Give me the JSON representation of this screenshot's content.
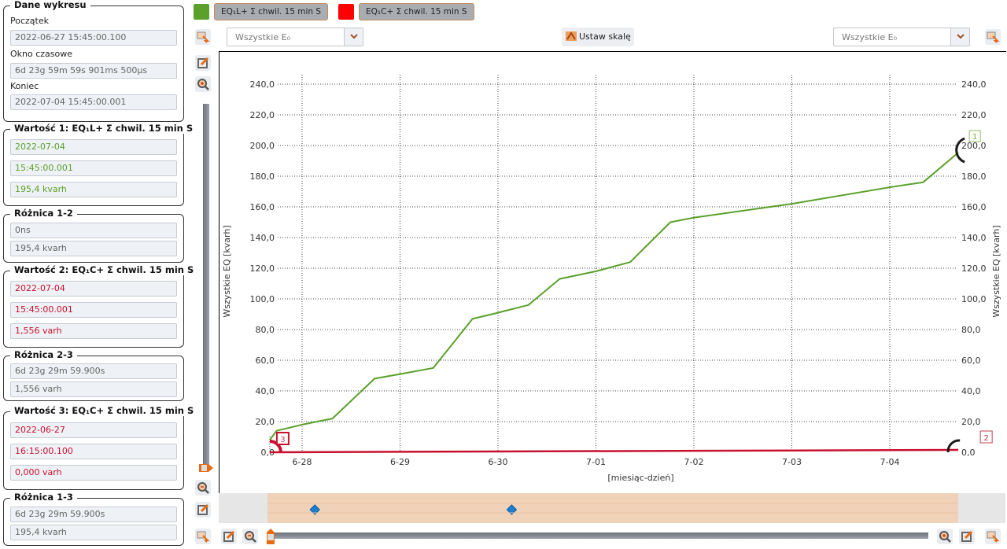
{
  "legend": {
    "series1": {
      "label": "EQ₁L+ Σ chwil. 15 min S",
      "color": "#5aa02a"
    },
    "series2": {
      "label": "EQ₁C+ Σ chwil. 15 min S",
      "color": "#e8140c"
    }
  },
  "toolbar": {
    "left_dropdown": "Wszystkie E₀",
    "right_dropdown": "Wszystkie E₀",
    "set_scale_label": "Ustaw skalę"
  },
  "panel": {
    "chart_data_group": {
      "title": "Dane wykresu",
      "start_label": "Początek",
      "start_value": "2022-06-27 15:45:00.100",
      "window_label": "Okno czasowe",
      "window_value": "6d 23g 59m 59s 901ms 500µs",
      "end_label": "Koniec",
      "end_value": "2022-07-04 15:45:00.001"
    },
    "value1": {
      "title": "Wartość 1: EQ₁L+ Σ chwil. 15 min S",
      "date": "2022-07-04",
      "time": "15:45:00.001",
      "value": "195,4 kvarh"
    },
    "diff12": {
      "title": "Różnica 1-2",
      "time": "0ns",
      "value": "195,4 kvarh"
    },
    "value2": {
      "title": "Wartość 2: EQ₁C+ Σ chwil. 15 min S",
      "date": "2022-07-04",
      "time": "15:45:00.001",
      "value": "1,556 varh"
    },
    "diff23": {
      "title": "Różnica 2-3",
      "time": "6d 23g 29m 59.900s",
      "value": "1,556 varh"
    },
    "value3": {
      "title": "Wartość 3: EQ₁C+ Σ chwil. 15 min S",
      "date": "2022-06-27",
      "time": "16:15:00.100",
      "value": "0,000 varh"
    },
    "diff13": {
      "title": "Różnica 1-3",
      "time": "6d 23g 29m 59.900s",
      "value": "195,4 kvarh"
    }
  },
  "chart_data": {
    "type": "line",
    "xlabel": "[miesiąc-dzień]",
    "ylabel_left": "Wszystkie EQ [kvarh]",
    "ylabel_right": "Wszystkie EQ [kvarh]",
    "ylim": [
      0,
      240
    ],
    "yticks": [
      "0,0",
      "20,0",
      "40,0",
      "60,0",
      "80,0",
      "100,0",
      "120,0",
      "140,0",
      "160,0",
      "180,0",
      "200,0",
      "220,0",
      "240,0"
    ],
    "xlim_days": [
      -0.33,
      6.72
    ],
    "xticks": [
      "6-28",
      "6-29",
      "6-30",
      "7-01",
      "7-02",
      "7-03",
      "7-04"
    ],
    "grid": true,
    "series": [
      {
        "name": "EQ₁L+ Σ chwil. 15 min S",
        "color": "#5aa02a",
        "x_days": [
          -0.33,
          -0.26,
          0.0,
          0.31,
          0.74,
          1.0,
          1.34,
          1.74,
          2.0,
          2.31,
          2.63,
          3.0,
          3.35,
          3.76,
          4.0,
          5.0,
          6.02,
          6.34,
          6.7
        ],
        "values": [
          8,
          14,
          18,
          22,
          48,
          51,
          55,
          87,
          91,
          96,
          113,
          118,
          124,
          150,
          153,
          162,
          173,
          176,
          195.4
        ]
      },
      {
        "name": "EQ₁C+ Σ chwil. 15 min S",
        "color": "#c8102e",
        "x_days": [
          -0.33,
          6.7
        ],
        "values": [
          0,
          1.556
        ]
      }
    ],
    "markers": [
      {
        "id": "1",
        "series": 0,
        "x_day": 6.7,
        "value": 195.4
      },
      {
        "id": "2",
        "series": 1,
        "x_day": 6.7,
        "value": 0
      },
      {
        "id": "3",
        "series": 1,
        "x_day": -0.33,
        "value": 0
      }
    ],
    "navigator_markers_days": [
      0.13,
      2.14
    ]
  }
}
